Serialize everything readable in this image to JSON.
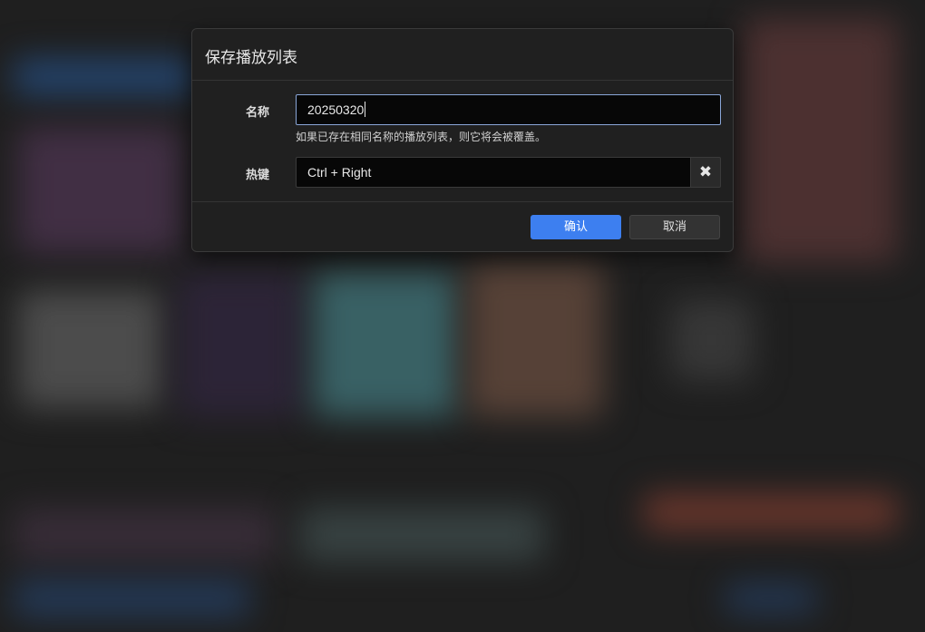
{
  "dialog": {
    "title": "保存播放列表",
    "name_label": "名称",
    "name_value": "20250320",
    "hint": "如果已存在相同名称的播放列表，则它将会被覆盖。",
    "hotkey_label": "热键",
    "hotkey_value": "Ctrl + Right",
    "clear_icon": "✖",
    "confirm_label": "确认",
    "cancel_label": "取消"
  },
  "colors": {
    "accent": "#3d7ff0",
    "dialog_bg": "#202020",
    "input_bg": "#070707",
    "focus_border": "#8aa6d8"
  }
}
